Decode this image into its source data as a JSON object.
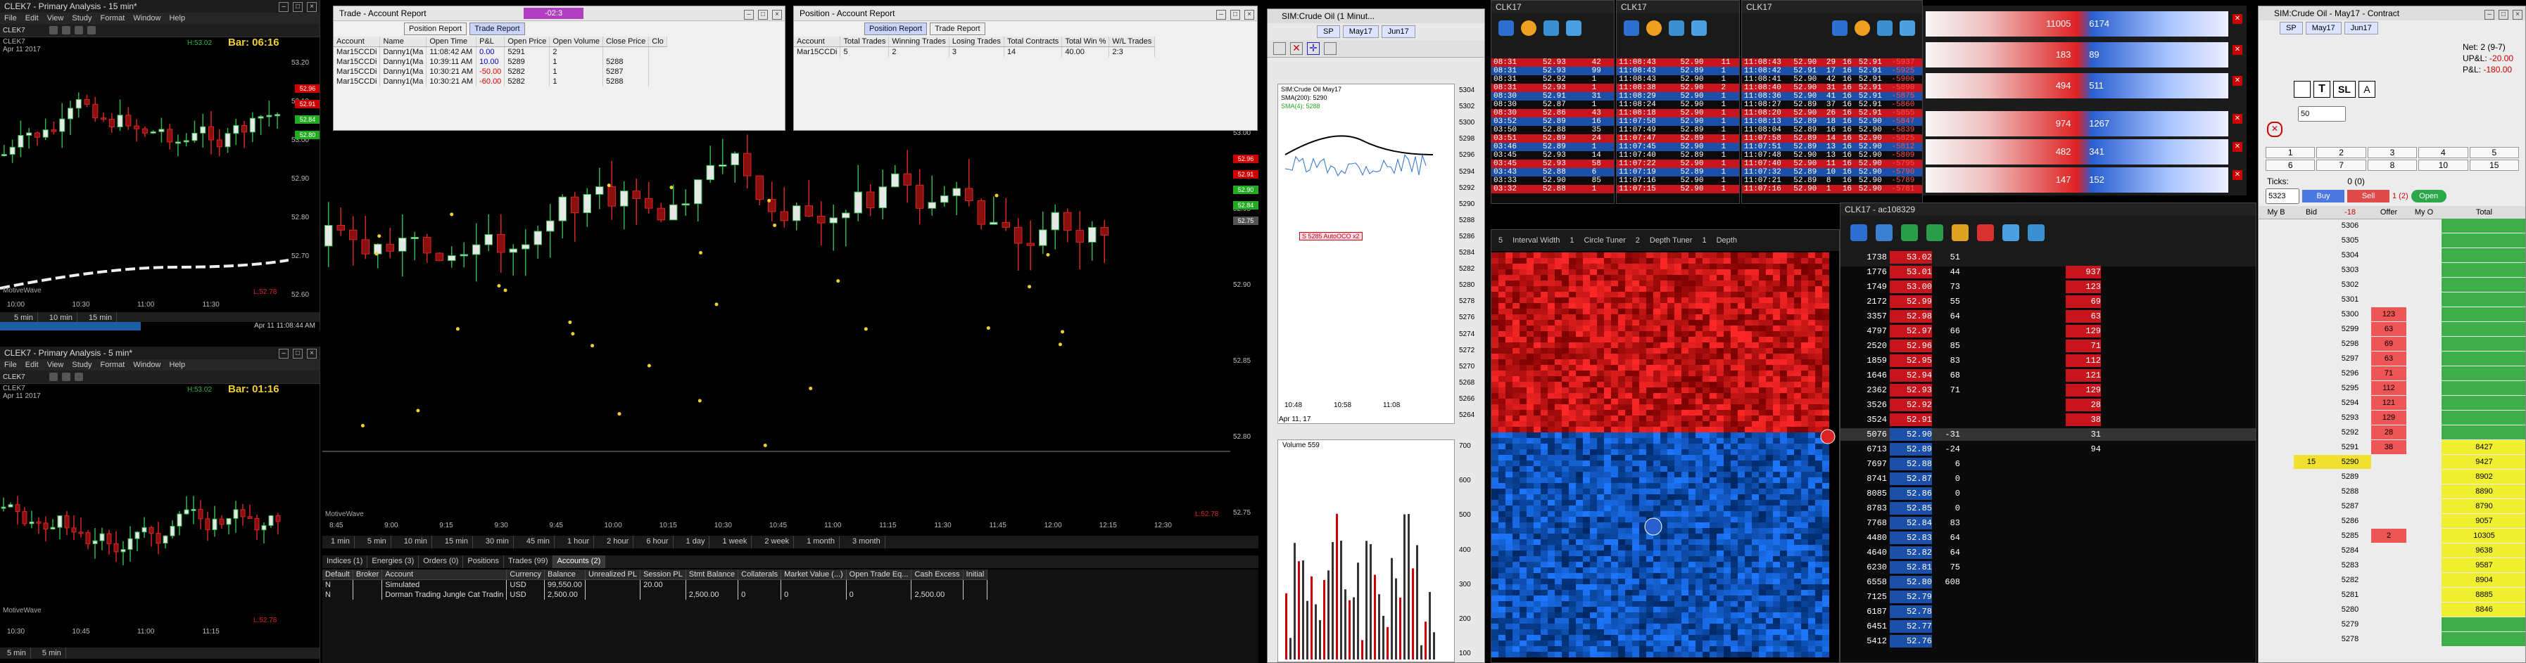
{
  "chart1": {
    "title": "CLEK7 - Primary Analysis - 15 min*",
    "menu": [
      "File",
      "Edit",
      "View",
      "Study",
      "Format",
      "Window",
      "Help"
    ],
    "symbol": "CLEK7",
    "date": "Apr 11 2017",
    "bar_timer": "Bar: 06:16",
    "h_label": "H:53.02",
    "l_label": "L:52.78",
    "x_labels": [
      "10:00",
      "10:30",
      "11:00",
      "11:30"
    ],
    "y_labels": [
      "53.20",
      "53.10",
      "53.00",
      "52.90",
      "52.80",
      "52.70",
      "52.60"
    ],
    "price_tags": [
      {
        "v": "52.96",
        "c": "#c00"
      },
      {
        "v": "52.91",
        "c": "#c00"
      },
      {
        "v": "52.84",
        "c": "#2a2"
      },
      {
        "v": "52.80",
        "c": "#2a2"
      }
    ],
    "watermark": "MotiveWave",
    "status_time": "Apr 11 11:08:44 AM",
    "bottom_tabs": [
      "5 min",
      "10 min",
      "15 min"
    ]
  },
  "chart2": {
    "title": "CLEK7 - Primary Analysis - 5 min*",
    "menu": [
      "File",
      "Edit",
      "View",
      "Study",
      "Format",
      "Window",
      "Help"
    ],
    "symbol": "CLEK7",
    "date": "Apr 11 2017",
    "bar_timer": "Bar: 01:16",
    "h_label": "H:53.02",
    "l_label": "L:52.78",
    "x_labels": [
      "10:30",
      "10:45",
      "11:00",
      "11:15"
    ],
    "watermark": "MotiveWave",
    "bottom_tabs": [
      "5 min",
      "5 min"
    ]
  },
  "main_chart": {
    "watermark": "MotiveWave",
    "l_label": "L:52.78",
    "x_labels": [
      "8:45",
      "9:00",
      "9:15",
      "9:30",
      "9:45",
      "10:00",
      "10:15",
      "10:30",
      "10:45",
      "11:00",
      "11:15",
      "11:30",
      "11:45",
      "12:00",
      "12:15",
      "12:30"
    ],
    "y_labels": [
      "53.00",
      "52.95",
      "52.90",
      "52.85",
      "52.80",
      "52.75"
    ],
    "price_tags": [
      {
        "v": "52.96",
        "c": "#c00"
      },
      {
        "v": "52.91",
        "c": "#c00"
      },
      {
        "v": "52.90",
        "c": "#2a2"
      },
      {
        "v": "52.84",
        "c": "#2a2"
      },
      {
        "v": "52.75",
        "c": "#555"
      }
    ],
    "tf_tabs": [
      "1 min",
      "5 min",
      "10 min",
      "15 min",
      "30 min",
      "45 min",
      "1 hour",
      "2 hour",
      "6 hour",
      "1 day",
      "1 week",
      "2 week",
      "1 month",
      "3 month"
    ],
    "account_tabs": [
      "Indices (1)",
      "Energies (3)",
      "Orders (0)",
      "Positions",
      "Trades (99)",
      "Accounts (2)"
    ],
    "active_tab": "Accounts (2)"
  },
  "accounts_table": {
    "headers": [
      "Default",
      "Broker",
      "Account",
      "Currency",
      "Balance",
      "Unrealized PL",
      "Session PL",
      "Stmt Balance",
      "Collaterals",
      "Market Value (...)",
      "Open Trade Eq...",
      "Cash Excess",
      "Initial"
    ],
    "rows": [
      [
        "N",
        "",
        "Simulated",
        "USD",
        "99,550.00",
        "",
        "20.00",
        "",
        "",
        "",
        "",
        "",
        ""
      ],
      [
        "N",
        "",
        "Dorman Trading Jungle Cat Tradin",
        "USD",
        "2,500.00",
        "",
        "",
        "2,500.00",
        "0",
        "0",
        "0",
        "2,500.00",
        ""
      ]
    ]
  },
  "trade_report": {
    "title": "Trade - Account Report",
    "badge": "-02:3",
    "tabs": [
      "Position Report",
      "Trade Report"
    ],
    "active": "Trade Report",
    "headers": [
      "Account",
      "Name",
      "Open Time",
      "P&L",
      "Open Price",
      "Open Volume",
      "Close Price",
      "Clo"
    ],
    "rows": [
      [
        "Mar15CCDi",
        "Danny1(Ma",
        "11:08:42 AM",
        "0.00",
        "5291",
        "2",
        ""
      ],
      [
        "Mar15CCDi",
        "Danny1(Ma",
        "10:39:11 AM",
        "10.00",
        "5289",
        "1",
        "5288"
      ],
      [
        "Mar15CCDi",
        "Danny1(Ma",
        "10:30:21 AM",
        "-50.00",
        "5282",
        "1",
        "5287"
      ],
      [
        "Mar15CCDi",
        "Danny1(Ma",
        "10:30:21 AM",
        "-60.00",
        "5282",
        "1",
        "5288"
      ]
    ]
  },
  "position_report": {
    "title": "Position - Account Report",
    "tabs": [
      "Position Report",
      "Trade Report"
    ],
    "active": "Position Report",
    "headers": [
      "Account",
      "Total Trades",
      "Winning Trades",
      "Losing Trades",
      "Total Contracts",
      "Total Win %",
      "W/L Trades"
    ],
    "rows": [
      [
        "Mar15CCDi",
        "5",
        "2",
        "3",
        "14",
        "40.00",
        "2:3"
      ]
    ]
  },
  "sim_chart": {
    "title": "SIM:Crude Oil (1 Minut...",
    "symbol": "SIM:Crude Oil May17",
    "sma_label": "SMA(200): 5290",
    "sma2_label": "SMA(4): 5288",
    "order_tag": "S 5285 AutoOCO x2",
    "y_labels": [
      "5304",
      "5302",
      "5300",
      "5298",
      "5296",
      "5294",
      "5292",
      "5290",
      "5288",
      "5286",
      "5284",
      "5282",
      "5280",
      "5278",
      "5276",
      "5274",
      "5272",
      "5270",
      "5268",
      "5266",
      "5264"
    ],
    "x_labels": [
      "10:48",
      "10:58",
      "11:08"
    ],
    "date": "Apr 11, 17",
    "volume_title": "Volume 559",
    "vol_y": [
      "700",
      "600",
      "500",
      "400",
      "300",
      "200",
      "100"
    ],
    "chips": [
      "SP",
      "May17",
      "Jun17"
    ]
  },
  "ts1": {
    "title": "CLK17",
    "rows": [
      [
        "08:31",
        "52.93",
        "42"
      ],
      [
        "08:31",
        "52.93",
        "99"
      ],
      [
        "08:31",
        "52.92",
        "1"
      ],
      [
        "08:31",
        "52.93",
        "1"
      ],
      [
        "08:30",
        "52.91",
        "31"
      ],
      [
        "08:30",
        "52.87",
        "1"
      ],
      [
        "08:30",
        "52.86",
        "43"
      ],
      [
        "03:52",
        "52.89",
        "16"
      ],
      [
        "03:50",
        "52.88",
        "35"
      ],
      [
        "03:51",
        "52.89",
        "24"
      ],
      [
        "03:46",
        "52.89",
        "1"
      ],
      [
        "03:45",
        "52.93",
        "14"
      ],
      [
        "03:45",
        "52.93",
        "58"
      ],
      [
        "03:43",
        "52.88",
        "6"
      ],
      [
        "03:33",
        "52.90",
        "85"
      ],
      [
        "03:32",
        "52.88",
        "1"
      ]
    ]
  },
  "ts2": {
    "title": "CLK17",
    "rows": [
      [
        "11:08:43",
        "52.90",
        "11"
      ],
      [
        "11:08:43",
        "52.89",
        "1"
      ],
      [
        "11:08:43",
        "52.90",
        "1"
      ],
      [
        "11:08:38",
        "52.90",
        "2"
      ],
      [
        "11:08:29",
        "52.90",
        "1"
      ],
      [
        "11:08:24",
        "52.90",
        "1"
      ],
      [
        "11:08:18",
        "52.90",
        "1"
      ],
      [
        "11:07:58",
        "52.90",
        "1"
      ],
      [
        "11:07:49",
        "52.89",
        "1"
      ],
      [
        "11:07:47",
        "52.89",
        "1"
      ],
      [
        "11:07:45",
        "52.90",
        "1"
      ],
      [
        "11:07:40",
        "52.89",
        "1"
      ],
      [
        "11:07:22",
        "52.90",
        "1"
      ],
      [
        "11:07:19",
        "52.89",
        "1"
      ],
      [
        "11:07:16",
        "52.90",
        "1"
      ],
      [
        "11:07:15",
        "52.90",
        "1"
      ]
    ]
  },
  "ts3": {
    "title": "CLK17",
    "rows": [
      [
        "11:08:43",
        "52.90",
        "29",
        "16",
        "52.91",
        "-5937"
      ],
      [
        "11:08:42",
        "52.91",
        "17",
        "16",
        "52.91",
        "-5925"
      ],
      [
        "11:08:41",
        "52.90",
        "42",
        "16",
        "52.91",
        "-5906"
      ],
      [
        "11:08:40",
        "52.90",
        "31",
        "16",
        "52.91",
        "-5890"
      ],
      [
        "11:08:36",
        "52.90",
        "41",
        "16",
        "52.91",
        "-5875"
      ],
      [
        "11:08:27",
        "52.89",
        "37",
        "16",
        "52.91",
        "-5860"
      ],
      [
        "11:08:20",
        "52.90",
        "26",
        "16",
        "52.91",
        "-5855"
      ],
      [
        "11:08:13",
        "52.89",
        "18",
        "16",
        "52.90",
        "-5847"
      ],
      [
        "11:08:04",
        "52.89",
        "16",
        "16",
        "52.90",
        "-5839"
      ],
      [
        "11:07:58",
        "52.89",
        "14",
        "16",
        "52.90",
        "-5825"
      ],
      [
        "11:07:51",
        "52.89",
        "13",
        "16",
        "52.90",
        "-5812"
      ],
      [
        "11:07:48",
        "52.90",
        "13",
        "16",
        "52.90",
        "-5809"
      ],
      [
        "11:07:40",
        "52.90",
        "11",
        "16",
        "52.90",
        "-5795"
      ],
      [
        "11:07:32",
        "52.89",
        "10",
        "16",
        "52.90",
        "-5790"
      ],
      [
        "11:07:21",
        "52.89",
        "8",
        "16",
        "52.90",
        "-5789"
      ],
      [
        "11:07:16",
        "52.90",
        "1",
        "16",
        "52.90",
        "-5781"
      ]
    ]
  },
  "dom_pressure": [
    {
      "left": "11005",
      "right": "6174"
    },
    {
      "left": "183",
      "right": "89"
    },
    {
      "left": "494",
      "right": "511"
    },
    {
      "left": "974",
      "right": "1267"
    },
    {
      "left": "482",
      "right": "341"
    },
    {
      "left": "147",
      "right": "152"
    }
  ],
  "heatmap": {
    "title": "CLK17 - ac108329",
    "toolbar": [
      "5",
      "Interval Width",
      "1",
      "Circle Tuner",
      "2",
      "Depth Tuner",
      "1",
      "Depth"
    ]
  },
  "ladder": {
    "title": "CLK17 - ac108329",
    "rows": [
      [
        "1738",
        "53.02",
        "51",
        "",
        ""
      ],
      [
        "1776",
        "53.01",
        "44",
        "937",
        ""
      ],
      [
        "1749",
        "53.00",
        "73",
        "123",
        ""
      ],
      [
        "2172",
        "52.99",
        "55",
        "69",
        ""
      ],
      [
        "3357",
        "52.98",
        "64",
        "63",
        ""
      ],
      [
        "4797",
        "52.97",
        "66",
        "129",
        ""
      ],
      [
        "2520",
        "52.96",
        "85",
        "71",
        ""
      ],
      [
        "1859",
        "52.95",
        "83",
        "112",
        ""
      ],
      [
        "1646",
        "52.94",
        "68",
        "121",
        ""
      ],
      [
        "2362",
        "52.93",
        "71",
        "129",
        ""
      ],
      [
        "3526",
        "52.92",
        "",
        "28",
        ""
      ],
      [
        "3524",
        "52.91",
        "",
        "38",
        ""
      ],
      [
        "5076",
        "52.90",
        "-31",
        "31",
        ""
      ],
      [
        "6713",
        "52.89",
        "-24",
        "94",
        ""
      ],
      [
        "7697",
        "52.88",
        "6",
        "",
        ""
      ],
      [
        "8741",
        "52.87",
        "0",
        "",
        ""
      ],
      [
        "8085",
        "52.86",
        "0",
        "",
        ""
      ],
      [
        "8783",
        "52.85",
        "0",
        "",
        ""
      ],
      [
        "7768",
        "52.84",
        "83",
        "",
        ""
      ],
      [
        "4480",
        "52.83",
        "64",
        "",
        ""
      ],
      [
        "4640",
        "52.82",
        "64",
        "",
        ""
      ],
      [
        "6230",
        "52.81",
        "75",
        "",
        ""
      ],
      [
        "6558",
        "52.80",
        "608",
        "",
        ""
      ],
      [
        "7125",
        "52.79",
        "",
        "",
        ""
      ],
      [
        "6187",
        "52.78",
        "",
        "",
        ""
      ],
      [
        "6451",
        "52.77",
        "",
        "",
        ""
      ],
      [
        "5412",
        "52.76",
        "",
        "",
        ""
      ]
    ]
  },
  "contract": {
    "title": "SIM:Crude Oil - May17 - Contract",
    "chips": [
      "SP",
      "May17",
      "Jun17"
    ],
    "net_label": "Net:",
    "net_value": "2 (9-7)",
    "upl_label": "UP&L:",
    "upl_value": "-20.00",
    "pl_label": "P&L:",
    "pl_value": "-180.00",
    "qty": "50",
    "ticks_label": "Ticks:",
    "ticks_value": "0 (0)",
    "price_input": "5323",
    "buy_label": "Buy",
    "sell_label": "Sell",
    "sell_count": "1 (2)",
    "open_label": "Open",
    "cols": [
      "My B",
      "Bid",
      "-18",
      "Offer",
      "My O",
      "Total"
    ],
    "qty_buttons": [
      "1",
      "2",
      "3",
      "4",
      "5",
      "6",
      "7",
      "8",
      "10",
      "15"
    ],
    "ladder": [
      [
        "5306",
        "",
        "",
        ""
      ],
      [
        "5305",
        "",
        "",
        ""
      ],
      [
        "5304",
        "",
        "",
        ""
      ],
      [
        "5303",
        "",
        "",
        ""
      ],
      [
        "5302",
        "",
        "",
        ""
      ],
      [
        "5301",
        "",
        "",
        ""
      ],
      [
        "5300",
        "",
        "123",
        ""
      ],
      [
        "5299",
        "",
        "63",
        ""
      ],
      [
        "5298",
        "",
        "69",
        ""
      ],
      [
        "5297",
        "",
        "63",
        ""
      ],
      [
        "5296",
        "",
        "71",
        ""
      ],
      [
        "5295",
        "",
        "112",
        ""
      ],
      [
        "5294",
        "",
        "121",
        ""
      ],
      [
        "5293",
        "",
        "129",
        ""
      ],
      [
        "5292",
        "",
        "28",
        ""
      ],
      [
        "5291",
        "",
        "38",
        "8427"
      ],
      [
        "5290",
        "15",
        "",
        "9427"
      ],
      [
        "5289",
        "",
        "",
        "8902"
      ],
      [
        "5288",
        "",
        "",
        "8890"
      ],
      [
        "5287",
        "",
        "",
        "8790"
      ],
      [
        "5286",
        "",
        "",
        "9057"
      ],
      [
        "5285",
        "",
        "2",
        "10305"
      ],
      [
        "5284",
        "",
        "",
        "9638"
      ],
      [
        "5283",
        "",
        "",
        "9587"
      ],
      [
        "5282",
        "",
        "",
        "8904"
      ],
      [
        "5281",
        "",
        "",
        "8885"
      ],
      [
        "5280",
        "",
        "",
        "8846"
      ],
      [
        "5279",
        "",
        "",
        ""
      ],
      [
        "5278",
        "",
        "",
        ""
      ]
    ]
  },
  "colors": {
    "up": "#2fb34a",
    "down": "#d92424",
    "bg": "#000000",
    "accent": "#3a6fd8"
  }
}
